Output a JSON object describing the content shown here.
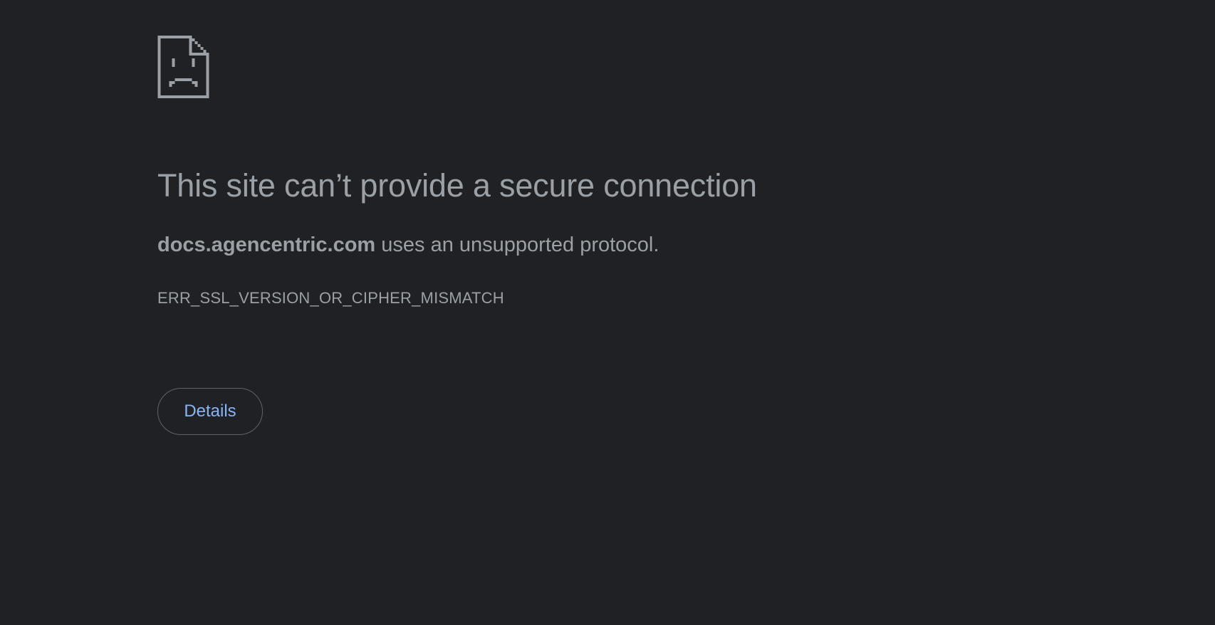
{
  "icon": "sad-page-icon",
  "heading": "This site can’t provide a secure connection",
  "summary": {
    "host": "docs.agencentric.com",
    "message": " uses an unsupported protocol."
  },
  "error_code": "ERR_SSL_VERSION_OR_CIPHER_MISMATCH",
  "buttons": {
    "details_label": "Details"
  },
  "colors": {
    "background": "#202124",
    "text": "#9aa0a6",
    "link": "#8ab4f8",
    "button_border": "#5f6368"
  }
}
